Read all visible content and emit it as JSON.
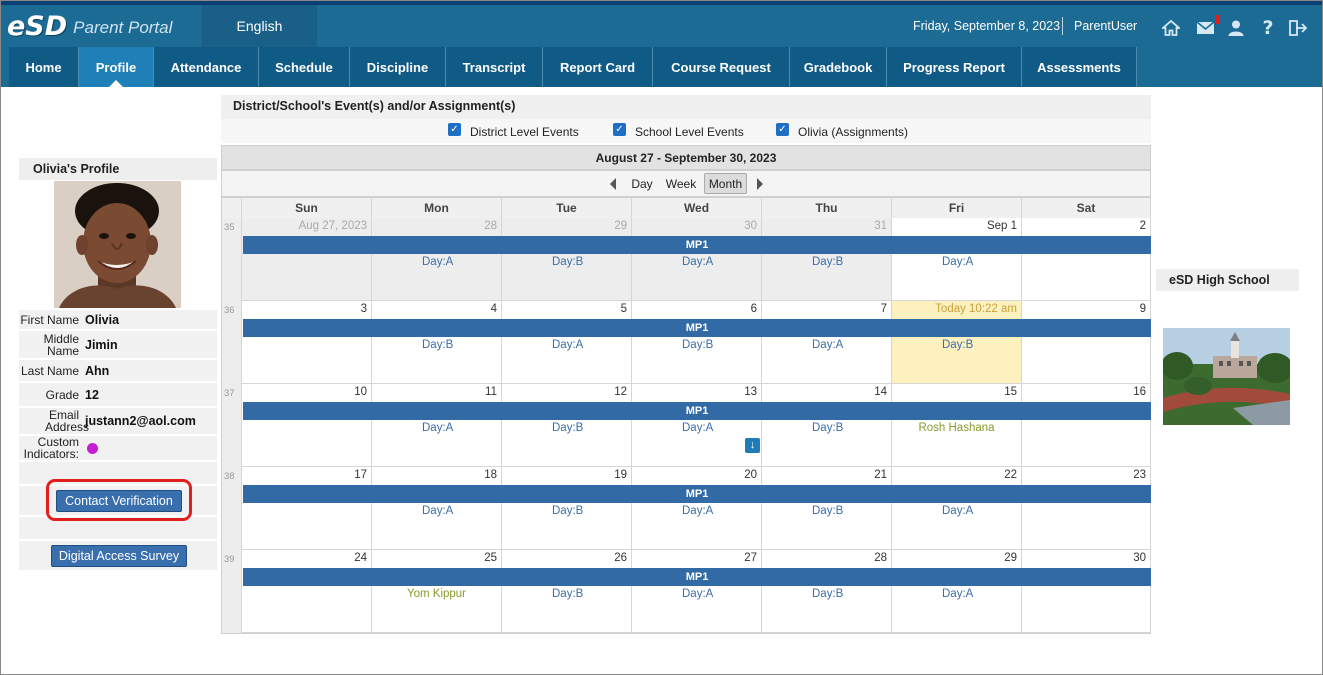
{
  "header": {
    "logo_brand": "eSD",
    "logo_subtitle": "Parent Portal",
    "language": "English",
    "date": "Friday, September 8, 2023",
    "user": "ParentUser",
    "icons": [
      "home-icon",
      "mail-icon",
      "user-icon",
      "help-icon",
      "logout-icon"
    ]
  },
  "nav": {
    "items": [
      {
        "label": "Home"
      },
      {
        "label": "Profile",
        "active": true
      },
      {
        "label": "Attendance"
      },
      {
        "label": "Schedule"
      },
      {
        "label": "Discipline"
      },
      {
        "label": "Transcript"
      },
      {
        "label": "Report Card"
      },
      {
        "label": "Course Request"
      },
      {
        "label": "Gradebook"
      },
      {
        "label": "Progress Report"
      },
      {
        "label": "Assessments"
      }
    ]
  },
  "profile": {
    "title": "Olivia's Profile",
    "fields": [
      {
        "label": "First Name",
        "value": "Olivia"
      },
      {
        "label": "Middle Name",
        "value": "Jimin"
      },
      {
        "label": "Last Name",
        "value": "Ahn"
      },
      {
        "label": "Grade",
        "value": "12"
      },
      {
        "label": "Email Address",
        "value": "justann2@aol.com"
      },
      {
        "label": "Custom Indicators:",
        "value": ""
      }
    ],
    "contact_button": "Contact Verification",
    "survey_button": "Digital Access Survey"
  },
  "events": {
    "title": "District/School's Event(s) and/or Assignment(s)",
    "filters": [
      {
        "label": "District Level Events",
        "checked": true
      },
      {
        "label": "School Level Events",
        "checked": true
      },
      {
        "label": "Olivia (Assignments)",
        "checked": true
      }
    ]
  },
  "calendar": {
    "range": "August 27 - September 30, 2023",
    "views": [
      "Day",
      "Week",
      "Month"
    ],
    "active_view": "Month",
    "day_headers": [
      "Sun",
      "Mon",
      "Tue",
      "Wed",
      "Thu",
      "Fri",
      "Sat"
    ],
    "mp_label": "MP1",
    "weeks": [
      {
        "num": "35",
        "days": [
          {
            "label": "Aug 27, 2023",
            "dim": true,
            "event": ""
          },
          {
            "label": "28",
            "dim": true,
            "event": "Day:A"
          },
          {
            "label": "29",
            "dim": true,
            "event": "Day:B"
          },
          {
            "label": "30",
            "dim": true,
            "event": "Day:A"
          },
          {
            "label": "31",
            "dim": true,
            "event": "Day:B"
          },
          {
            "label": "Sep 1",
            "event": "Day:A"
          },
          {
            "label": "2",
            "event": ""
          }
        ]
      },
      {
        "num": "36",
        "days": [
          {
            "label": "3",
            "event": ""
          },
          {
            "label": "4",
            "event": "Day:B"
          },
          {
            "label": "5",
            "event": "Day:A"
          },
          {
            "label": "6",
            "event": "Day:B"
          },
          {
            "label": "7",
            "event": "Day:A"
          },
          {
            "label": "Today 10:22 am",
            "today": true,
            "event": "Day:B"
          },
          {
            "label": "9",
            "event": ""
          }
        ]
      },
      {
        "num": "37",
        "days": [
          {
            "label": "10",
            "event": ""
          },
          {
            "label": "11",
            "event": "Day:A"
          },
          {
            "label": "12",
            "event": "Day:B"
          },
          {
            "label": "13",
            "event": "Day:A",
            "more": true
          },
          {
            "label": "14",
            "event": "Day:B"
          },
          {
            "label": "15",
            "event": "Rosh Hashana",
            "holiday": true
          },
          {
            "label": "16",
            "event": ""
          }
        ]
      },
      {
        "num": "38",
        "days": [
          {
            "label": "17",
            "event": ""
          },
          {
            "label": "18",
            "event": "Day:A"
          },
          {
            "label": "19",
            "event": "Day:B"
          },
          {
            "label": "20",
            "event": "Day:A"
          },
          {
            "label": "21",
            "event": "Day:B"
          },
          {
            "label": "22",
            "event": "Day:A"
          },
          {
            "label": "23",
            "event": ""
          }
        ]
      },
      {
        "num": "39",
        "days": [
          {
            "label": "24",
            "event": ""
          },
          {
            "label": "25",
            "event": "Yom Kippur",
            "holiday": true
          },
          {
            "label": "26",
            "event": "Day:B"
          },
          {
            "label": "27",
            "event": "Day:A"
          },
          {
            "label": "28",
            "event": "Day:B"
          },
          {
            "label": "29",
            "event": "Day:A"
          },
          {
            "label": "30",
            "event": ""
          }
        ]
      }
    ]
  },
  "school": {
    "name": "eSD High School"
  },
  "colors": {
    "topbar": "#1c6b94",
    "nav_active": "#1f80b7",
    "mp_bar": "#326aa6",
    "today": "#fdf1bf",
    "holiday_text": "#8a9a2a",
    "day_text": "#3b6ea8",
    "highlight_ring": "#e02020"
  }
}
